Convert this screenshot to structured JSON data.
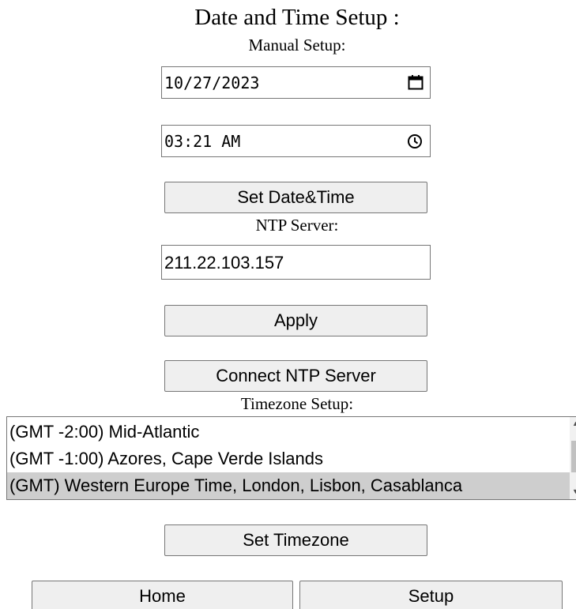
{
  "page": {
    "title": "Date and Time Setup :"
  },
  "manual_setup": {
    "label": "Manual Setup:",
    "date_value": "10/27/2023",
    "time_value": "03:21 AM",
    "set_button_label": "Set Date&Time"
  },
  "ntp": {
    "label": "NTP Server:",
    "server_value": "211.22.103.157",
    "apply_button_label": "Apply",
    "connect_button_label": "Connect NTP Server"
  },
  "timezone": {
    "label": "Timezone Setup:",
    "options": [
      "(GMT -2:00) Mid-Atlantic",
      "(GMT -1:00) Azores, Cape Verde Islands",
      "(GMT) Western Europe Time, London, Lisbon, Casablanca"
    ],
    "selected_index": 2,
    "set_button_label": "Set Timezone"
  },
  "nav": {
    "home_label": "Home",
    "setup_label": "Setup"
  },
  "icons": {
    "date_picker": "calendar-icon",
    "time_picker": "clock-icon"
  }
}
